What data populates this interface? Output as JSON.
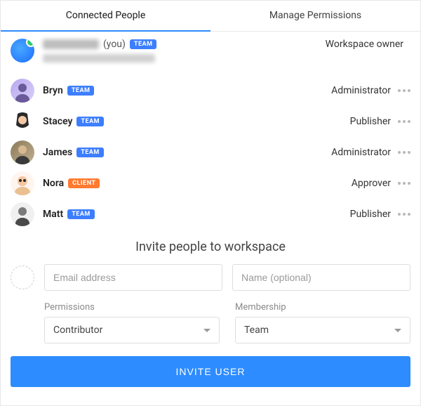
{
  "tabs": {
    "connected": "Connected People",
    "manage": "Manage Permissions"
  },
  "people": [
    {
      "name_redacted": true,
      "you_suffix": "(you)",
      "badge": {
        "label": "TEAM",
        "type": "team"
      },
      "role": "Workspace owner",
      "has_more": false
    },
    {
      "name": "Bryn",
      "badge": {
        "label": "TEAM",
        "type": "team"
      },
      "role": "Administrator",
      "has_more": true
    },
    {
      "name": "Stacey",
      "badge": {
        "label": "TEAM",
        "type": "team"
      },
      "role": "Publisher",
      "has_more": true
    },
    {
      "name": "James",
      "badge": {
        "label": "TEAM",
        "type": "team"
      },
      "role": "Administrator",
      "has_more": true
    },
    {
      "name": "Nora",
      "badge": {
        "label": "CLIENT",
        "type": "client"
      },
      "role": "Approver",
      "has_more": true
    },
    {
      "name": "Matt",
      "badge": {
        "label": "TEAM",
        "type": "team"
      },
      "role": "Publisher",
      "has_more": true
    }
  ],
  "invite": {
    "title": "Invite people to workspace",
    "email_placeholder": "Email address",
    "name_placeholder": "Name (optional)",
    "permissions_label": "Permissions",
    "permissions_value": "Contributor",
    "membership_label": "Membership",
    "membership_value": "Team",
    "button": "INVITE USER"
  }
}
